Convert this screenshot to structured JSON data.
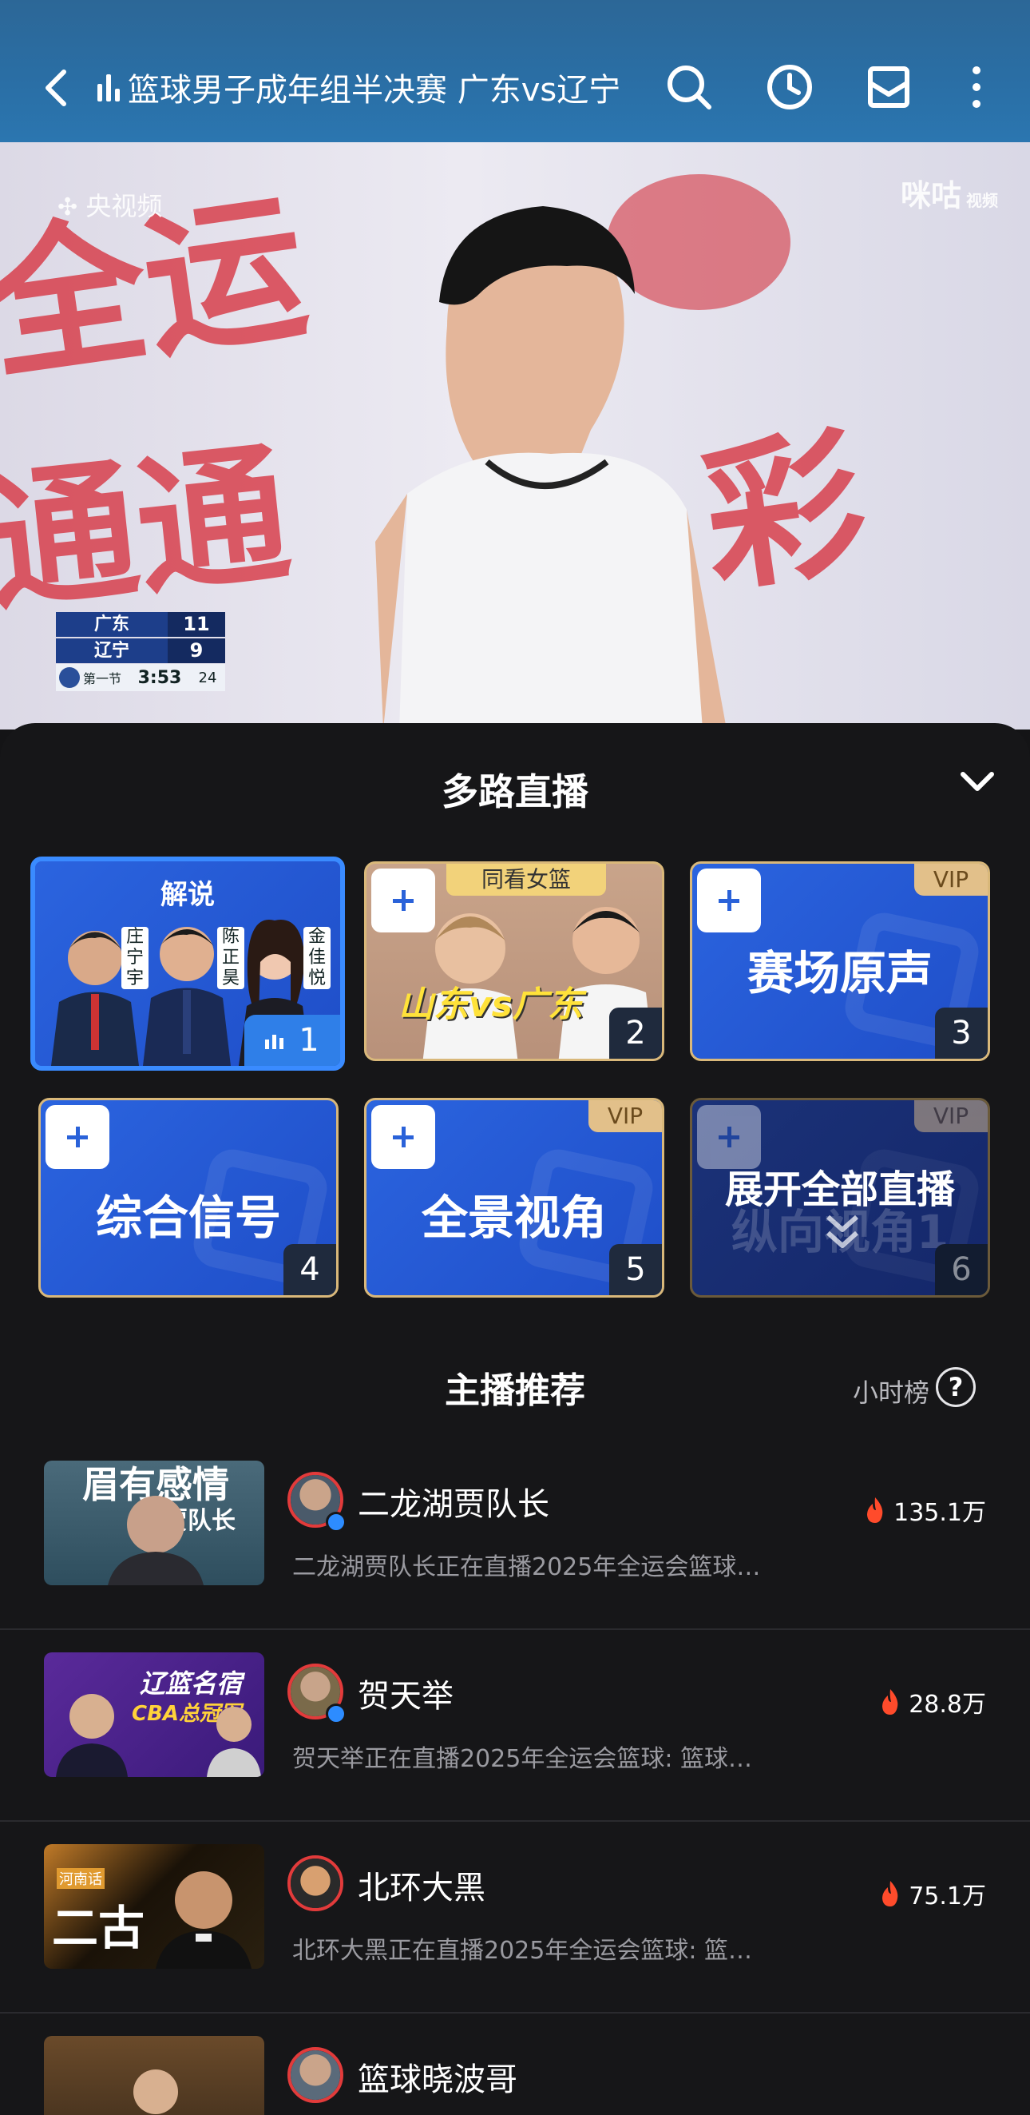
{
  "header": {
    "title": "篮球男子成年组半决赛 广东vs辽宁"
  },
  "video": {
    "broadcaster": "央视频",
    "platform": "咪咕",
    "platform_sub": "视频",
    "scoreboard": {
      "home_team": "广东",
      "home_score": "11",
      "away_team": "辽宁",
      "away_score": "9",
      "period": "第一节",
      "clock": "3:53",
      "shot_clock": "24"
    }
  },
  "panel": {
    "title": "多路直播",
    "tiles": [
      {
        "label": "解说",
        "number": "1",
        "commentators": [
          "庄宁宇",
          "陈正昊",
          "金佳悦"
        ]
      },
      {
        "label": "同看女篮",
        "overlay": "山东vs广东",
        "number": "2"
      },
      {
        "label": "赛场原声",
        "number": "3",
        "badge": "VIP"
      },
      {
        "label": "综合信号",
        "number": "4"
      },
      {
        "label": "全景视角",
        "number": "5",
        "badge": "VIP"
      },
      {
        "label": "展开全部直播",
        "number": "6",
        "badge": "VIP",
        "ghost": "纵向视角1"
      }
    ]
  },
  "recommend": {
    "title": "主播推荐",
    "rank_label": "小时榜",
    "help": "?",
    "streamers": [
      {
        "name": "二龙湖贾队长",
        "desc": "二龙湖贾队长正在直播2025年全运会篮球…",
        "heat": "135.1万",
        "thumb_text": "眉有感情",
        "thumb_sub": "贾队长"
      },
      {
        "name": "贺天举",
        "desc": "贺天举正在直播2025年全运会篮球: 篮球…",
        "heat": "28.8万",
        "thumb_text": "辽篮名宿",
        "thumb_sub": "CBA总冠军"
      },
      {
        "name": "北环大黑",
        "desc": "北环大黑正在直播2025年全运会篮球: 篮…",
        "heat": "75.1万",
        "thumb_text": "二古",
        "thumb_sub": "河南话"
      },
      {
        "name": "篮球晓波哥",
        "desc": "",
        "heat": "",
        "thumb_text": "",
        "thumb_sub": ""
      }
    ]
  }
}
